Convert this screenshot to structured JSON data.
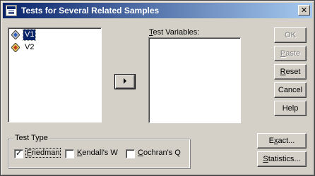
{
  "window": {
    "title": "Tests for Several Related Samples",
    "close_glyph": "✕"
  },
  "source_list": {
    "items": [
      {
        "label": "V1",
        "selected": true
      },
      {
        "label": "V2",
        "selected": false
      }
    ]
  },
  "move_button": {
    "glyph": "▶"
  },
  "test_variables": {
    "label_prefix": "",
    "label_underlined": "T",
    "label_rest": "est Variables:"
  },
  "buttons": {
    "ok": {
      "label": "OK",
      "enabled": false
    },
    "paste": {
      "label_underlined": "P",
      "label_rest": "aste",
      "enabled": false
    },
    "reset": {
      "label_underlined": "R",
      "label_rest": "eset",
      "enabled": true
    },
    "cancel": {
      "label": "Cancel",
      "enabled": true
    },
    "help": {
      "label": "Help",
      "enabled": true
    },
    "exact": {
      "label_prefix": "E",
      "label_underlined": "x",
      "label_rest": "act...",
      "enabled": true
    },
    "statistics": {
      "label_underlined": "S",
      "label_rest": "tatistics...",
      "enabled": true
    }
  },
  "test_type": {
    "legend": "Test Type",
    "options": [
      {
        "underlined": "F",
        "rest": "riedman",
        "checked": true
      },
      {
        "underlined": "K",
        "rest": "endall's W",
        "checked": false
      },
      {
        "underlined": "C",
        "rest": "ochran's Q",
        "checked": false
      }
    ]
  }
}
